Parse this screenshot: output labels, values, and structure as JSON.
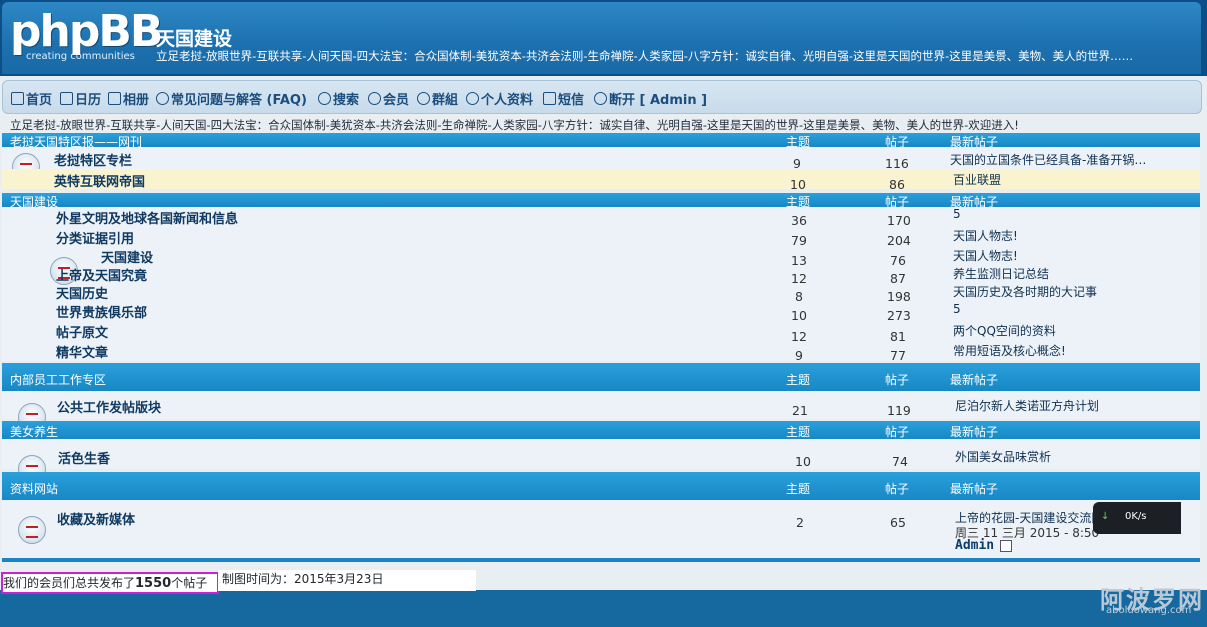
{
  "header": {
    "logo_main": "phpBB",
    "logo_sub": "creating  communities",
    "site_title": "天国建设",
    "site_desc": "立足老挝-放眼世界-互联共享-人间天国-四大法宝：合众国体制-美犹资本-共济会法则-生命禅院-人类家园-八字方针：诚实自律、光明自强-这里是天国的世界-这里是美景、美物、美人的世界……"
  },
  "nav": {
    "items": [
      {
        "label": "首页",
        "icon": "home-icon"
      },
      {
        "label": "日历",
        "icon": "calendar-icon"
      },
      {
        "label": "相册",
        "icon": "album-icon"
      },
      {
        "label": "常见问题与解答 (FAQ)",
        "icon": "help-icon"
      },
      {
        "label": "搜索",
        "icon": "search-icon"
      },
      {
        "label": "会员",
        "icon": "member-icon"
      },
      {
        "label": "群組",
        "icon": "group-icon"
      },
      {
        "label": "个人资料",
        "icon": "profile-icon"
      },
      {
        "label": "短信",
        "icon": "mail-icon"
      },
      {
        "label": "断开 [ Admin ]",
        "icon": "logout-icon"
      }
    ]
  },
  "ticker": "立足老挝-放眼世界-互联共享-人间天国-四大法宝：合众国体制-美犹资本-共济会法则-生命禅院-人类家园-八字方针：诚实自律、光明自强-这里是天国的世界-这里是美景、美物、美人的世界-欢迎进入!",
  "columns": {
    "topics": "主题",
    "posts": "帖子",
    "last": "最新帖子"
  },
  "categories": [
    {
      "title": "老挝天国特区报——网刊",
      "forums": [
        {
          "name": "老挝特区专栏",
          "topics": "9",
          "posts": "116",
          "last": "天国的立国条件已经具备-准备开锅…"
        },
        {
          "name": "英特互联网帝国",
          "topics": "10",
          "posts": "86",
          "last": "百业联盟"
        }
      ]
    },
    {
      "title": "天国建设",
      "forums": [
        {
          "name": "外星文明及地球各国新闻和信息",
          "topics": "36",
          "posts": "170",
          "last": "5"
        },
        {
          "name": "分类证据引用",
          "topics": "79",
          "posts": "204",
          "last": "天国人物志!"
        },
        {
          "name": "天国建设",
          "topics": "13",
          "posts": "76",
          "last": "天国人物志!"
        },
        {
          "name": "上帝及天国究竟",
          "topics": "12",
          "posts": "87",
          "last": "养生监测日记总结"
        },
        {
          "name": "天国历史",
          "topics": "8",
          "posts": "198",
          "last": "天国历史及各时期的大记事"
        },
        {
          "name": "世界贵族俱乐部",
          "topics": "10",
          "posts": "273",
          "last": "5"
        },
        {
          "name": "帖子原文",
          "topics": "12",
          "posts": "81",
          "last": "两个QQ空间的资料"
        },
        {
          "name": "精华文章",
          "topics": "9",
          "posts": "77",
          "last": "常用短语及核心概念!"
        }
      ]
    },
    {
      "title": "内部员工工作专区",
      "forums": [
        {
          "name": "公共工作发帖版块",
          "topics": "21",
          "posts": "119",
          "last": "尼泊尔新人类诺亚方舟计划"
        }
      ]
    },
    {
      "title": "美女养生",
      "forums": [
        {
          "name": "活色生香",
          "topics": "10",
          "posts": "74",
          "last": "外国美女品味赏析"
        }
      ]
    },
    {
      "title": "资料网站",
      "forums": [
        {
          "name": "收藏及新媒体",
          "topics": "2",
          "posts": "65",
          "last": "上帝的花园-天国建设交流网",
          "last_time": "周三 11 三月 2015 - 8:50",
          "last_user": "Admin"
        }
      ]
    }
  ],
  "footer": {
    "stats_prefix": "我们的会员们总共发布了",
    "stats_count": "1550",
    "stats_suffix": "个帖子",
    "capture_time": "制图时间为：2015年3月23日",
    "speed": "0K/s",
    "watermark": "阿波罗网",
    "watermark_url": "aboluowang.com"
  }
}
